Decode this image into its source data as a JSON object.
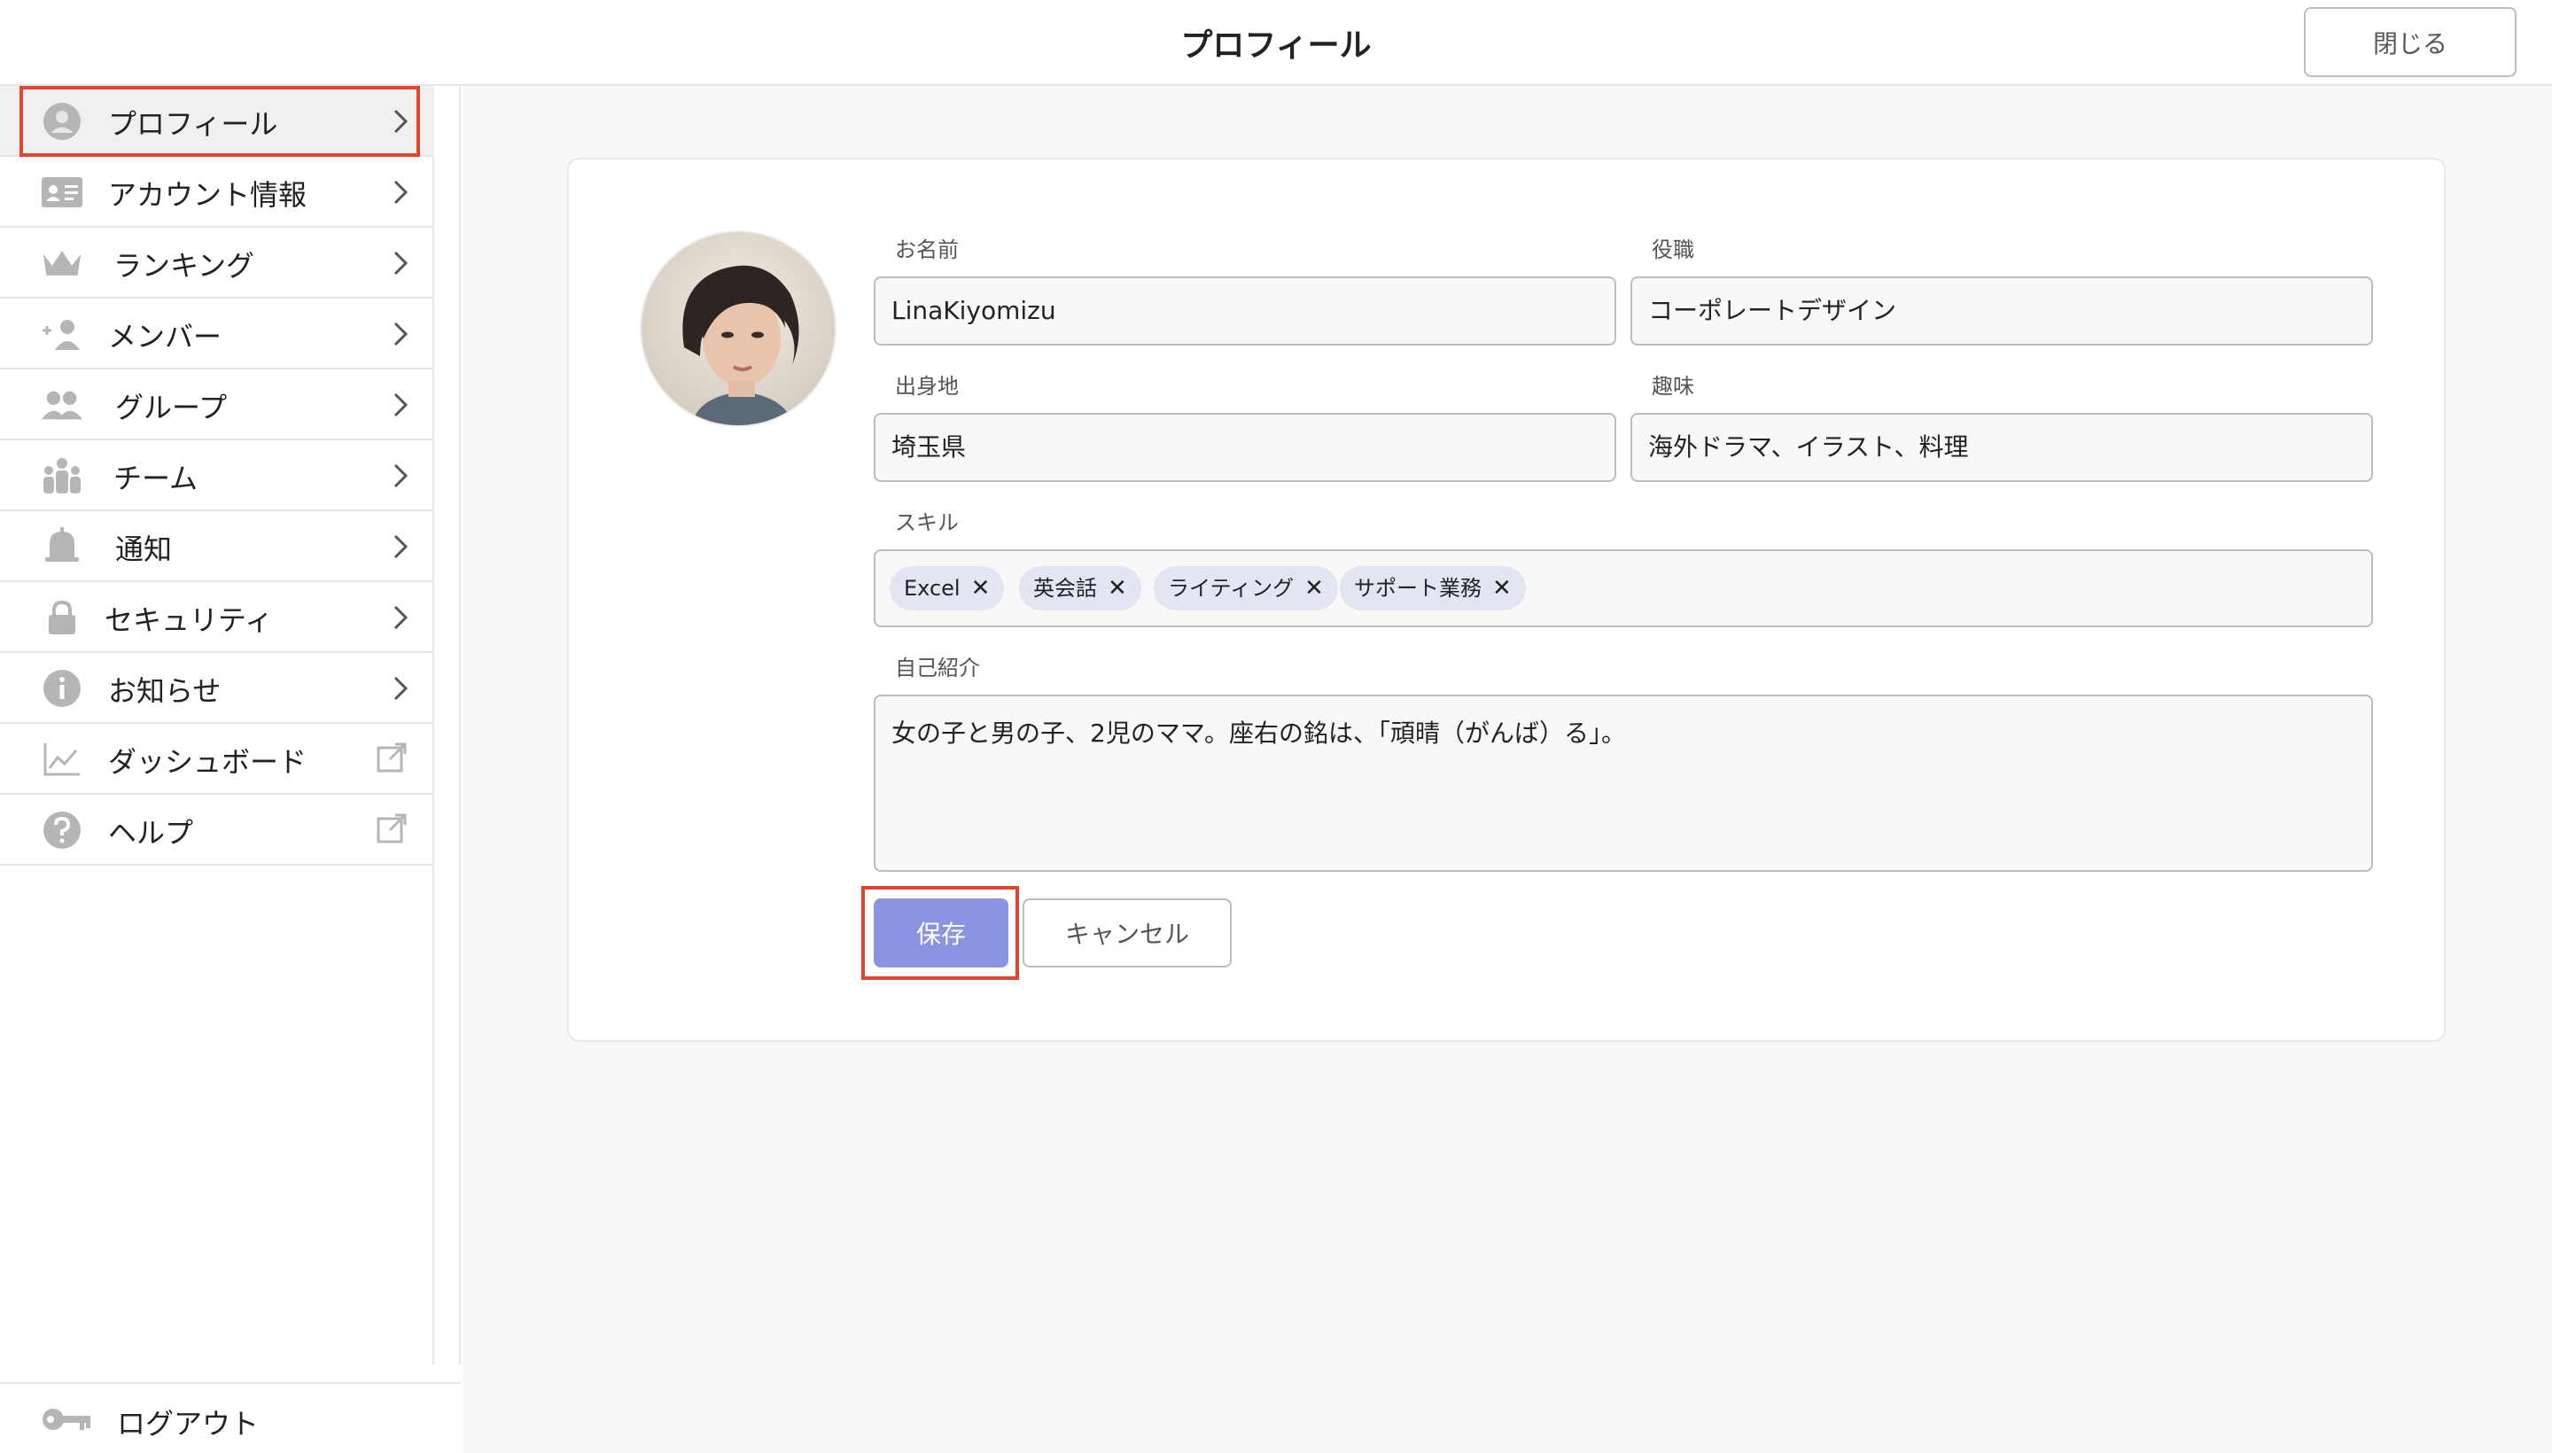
{
  "header": {
    "title": "プロフィール",
    "close_label": "閉じる"
  },
  "sidebar": {
    "items": [
      {
        "label": "プロフィール",
        "icon": "user-circle-icon",
        "trail": "chevron-right-icon",
        "active": true
      },
      {
        "label": "アカウント情報",
        "icon": "id-card-icon",
        "trail": "chevron-right-icon"
      },
      {
        "label": "ランキング",
        "icon": "crown-icon",
        "trail": "chevron-right-icon"
      },
      {
        "label": "メンバー",
        "icon": "add-user-icon",
        "trail": "chevron-right-icon"
      },
      {
        "label": "グループ",
        "icon": "users-icon",
        "trail": "chevron-right-icon"
      },
      {
        "label": "チーム",
        "icon": "team-icon",
        "trail": "chevron-right-icon"
      },
      {
        "label": "通知",
        "icon": "bell-icon",
        "trail": "chevron-right-icon"
      },
      {
        "label": "セキュリティ",
        "icon": "lock-icon",
        "trail": "chevron-right-icon"
      },
      {
        "label": "お知らせ",
        "icon": "info-icon",
        "trail": "chevron-right-icon"
      },
      {
        "label": "ダッシュボード",
        "icon": "chart-line-icon",
        "trail": "external-link-icon"
      },
      {
        "label": "ヘルプ",
        "icon": "help-icon",
        "trail": "external-link-icon"
      }
    ],
    "logout_label": "ログアウト"
  },
  "profile": {
    "name_label": "お名前",
    "name_value": "LinaKiyomizu",
    "role_label": "役職",
    "role_value": "コーポレートデザイン",
    "hometown_label": "出身地",
    "hometown_value": "埼玉県",
    "hobby_label": "趣味",
    "hobby_value": "海外ドラマ、イラスト、料理",
    "skills_label": "スキル",
    "skills": [
      "Excel",
      "英会話",
      "ライティング",
      "サポート業務"
    ],
    "bio_label": "自己紹介",
    "bio_value": "女の子と男の子、2児のママ。座右の銘は、「頑晴（がんば）る」。",
    "save_label": "保存",
    "cancel_label": "キャンセル"
  },
  "colors": {
    "accent": "#8a94e0",
    "highlight": "#e0452e",
    "chip_bg": "#e3e5f3",
    "icon_gray": "#b5b5b5"
  }
}
